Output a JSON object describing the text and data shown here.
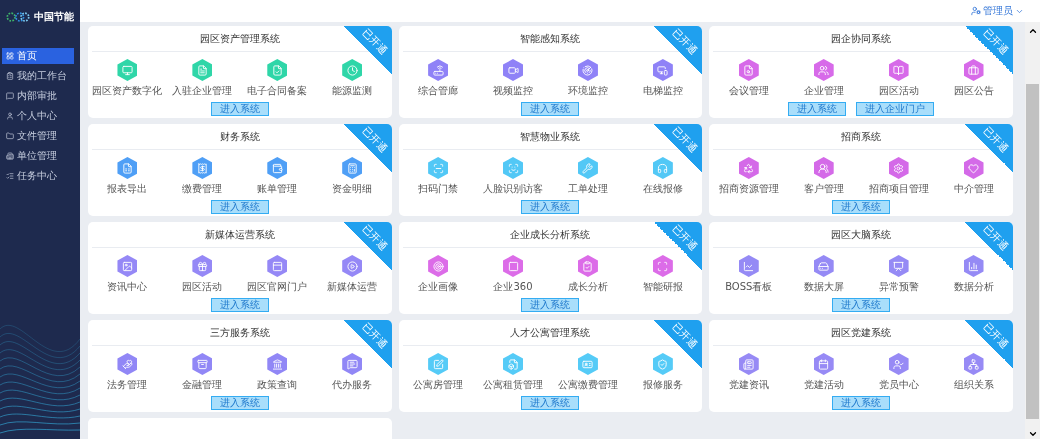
{
  "sidebar": {
    "logo": "中国节能",
    "items": [
      {
        "label": "首页",
        "selected": true
      },
      {
        "label": "我的工作台",
        "selected": false
      },
      {
        "label": "内部审批",
        "selected": false
      },
      {
        "label": "个人中心",
        "selected": false
      },
      {
        "label": "文件管理",
        "selected": false
      },
      {
        "label": "单位管理",
        "selected": false
      },
      {
        "label": "任务中心",
        "selected": false
      }
    ]
  },
  "header": {
    "user": "管理员"
  },
  "cards": [
    {
      "title": "园区资产管理系统",
      "ribbon": "已开通",
      "color": "#2fd6a8",
      "apps": [
        "园区资产数字化",
        "入驻企业管理",
        "电子合同备案",
        "能源监测"
      ],
      "buttons": [
        "进入系统"
      ]
    },
    {
      "title": "智能感知系统",
      "ribbon": "已开通",
      "color": "#8f82f7",
      "apps": [
        "综合管廊",
        "视频监控",
        "环境监控",
        "电梯监控"
      ],
      "buttons": [
        "进入系统"
      ]
    },
    {
      "title": "园企协同系统",
      "ribbon": "已开通",
      "color": "#d76ae9",
      "apps": [
        "会议管理",
        "企业管理",
        "园区活动",
        "园区公告"
      ],
      "buttons": [
        "进入系统",
        "进入企业门户"
      ]
    },
    {
      "title": "财务系统",
      "ribbon": "已开通",
      "color": "#4f9ff6",
      "apps": [
        "报表导出",
        "缴费管理",
        "账单管理",
        "资金明细"
      ],
      "buttons": [
        "进入系统"
      ]
    },
    {
      "title": "智慧物业系统",
      "ribbon": "已开通",
      "color": "#52c8f6",
      "apps": [
        "扫码门禁",
        "人脸识别访客",
        "工单处理",
        "在线报修"
      ],
      "buttons": [
        "进入系统"
      ]
    },
    {
      "title": "招商系统",
      "ribbon": "已开通",
      "color": "#d46ae8",
      "apps": [
        "招商资源管理",
        "客户管理",
        "招商项目管理",
        "中介管理"
      ],
      "buttons": [
        "进入系统"
      ]
    },
    {
      "title": "新媒体运营系统",
      "ribbon": "已开通",
      "color": "#9588f6",
      "apps": [
        "资讯中心",
        "园区活动",
        "园区官网门户",
        "新媒体运营"
      ],
      "buttons": [
        "进入系统"
      ]
    },
    {
      "title": "企业成长分析系统",
      "ribbon": "已开通",
      "color": "#dc6ce8",
      "apps": [
        "企业画像",
        "企业360",
        "成长分析",
        "智能研报"
      ],
      "buttons": [
        "进入系统"
      ]
    },
    {
      "title": "园区大脑系统",
      "ribbon": "已开通",
      "color": "#958af5",
      "apps": [
        "BOSS看板",
        "数据大屏",
        "异常预警",
        "数据分析"
      ],
      "buttons": [
        "进入系统"
      ]
    },
    {
      "title": "三方服务系统",
      "ribbon": "已开通",
      "color": "#9187f6",
      "apps": [
        "法务管理",
        "金融管理",
        "政策查询",
        "代办服务"
      ],
      "buttons": [
        "进入系统"
      ]
    },
    {
      "title": "人才公寓管理系统",
      "ribbon": "已开通",
      "color": "#55cbf7",
      "apps": [
        "公寓房管理",
        "公寓租赁管理",
        "公寓缴费管理",
        "报修服务"
      ],
      "buttons": [
        "进入系统"
      ]
    },
    {
      "title": "园区党建系统",
      "ribbon": "已开通",
      "color": "#978af5",
      "apps": [
        "党建资讯",
        "党建活动",
        "党员中心",
        "组织关系"
      ],
      "buttons": [
        "进入系统"
      ]
    }
  ]
}
